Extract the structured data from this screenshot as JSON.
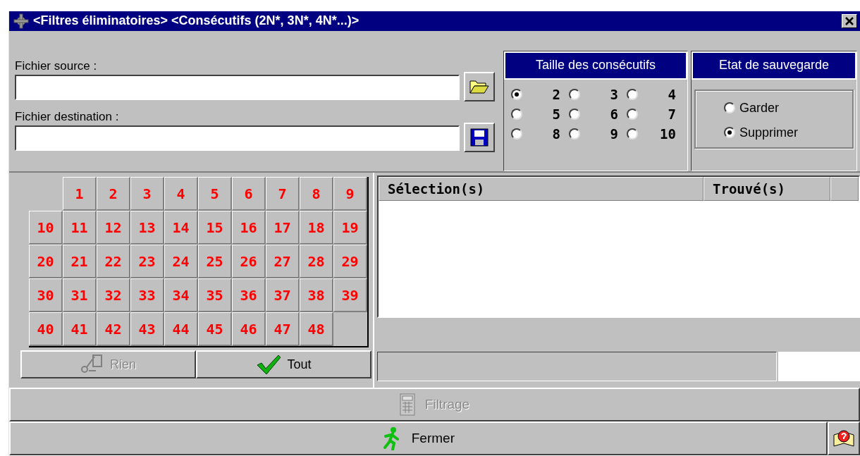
{
  "window": {
    "title": "<Filtres éliminatoires> <Consécutifs (2N*, 3N*, 4N*...)>"
  },
  "source_file": {
    "label": "Fichier source :"
  },
  "destination_file": {
    "label": "Fichier destination :"
  },
  "size_panel": {
    "title": "Taille des consécutifs",
    "options": [
      {
        "label": "2",
        "selected": true
      },
      {
        "label": "3",
        "selected": false
      },
      {
        "label": "4",
        "selected": false
      },
      {
        "label": "5",
        "selected": false
      },
      {
        "label": "6",
        "selected": false
      },
      {
        "label": "7",
        "selected": false
      },
      {
        "label": "8",
        "selected": false
      },
      {
        "label": "9",
        "selected": false
      },
      {
        "label": "10",
        "selected": false
      }
    ]
  },
  "save_panel": {
    "title": "Etat de sauvegarde",
    "options": [
      {
        "label": "Garder",
        "selected": false
      },
      {
        "label": "Supprimer",
        "selected": true
      }
    ]
  },
  "numbers": [
    "1",
    "2",
    "3",
    "4",
    "5",
    "6",
    "7",
    "8",
    "9",
    "10",
    "11",
    "12",
    "13",
    "14",
    "15",
    "16",
    "17",
    "18",
    "19",
    "20",
    "21",
    "22",
    "23",
    "24",
    "25",
    "26",
    "27",
    "28",
    "29",
    "30",
    "31",
    "32",
    "33",
    "34",
    "35",
    "36",
    "37",
    "38",
    "39",
    "40",
    "41",
    "42",
    "43",
    "44",
    "45",
    "46",
    "47",
    "48"
  ],
  "grid_buttons": [
    {
      "kind": "none",
      "label": "Rien",
      "disabled": true
    },
    {
      "kind": "all",
      "label": "Tout",
      "disabled": false
    }
  ],
  "results_table": {
    "columns": [
      "Sélection(s)",
      "Trouvé(s)"
    ]
  },
  "filter_button": {
    "label": "Filtrage",
    "disabled": true
  },
  "close_button": {
    "label": "Fermer",
    "disabled": false
  }
}
